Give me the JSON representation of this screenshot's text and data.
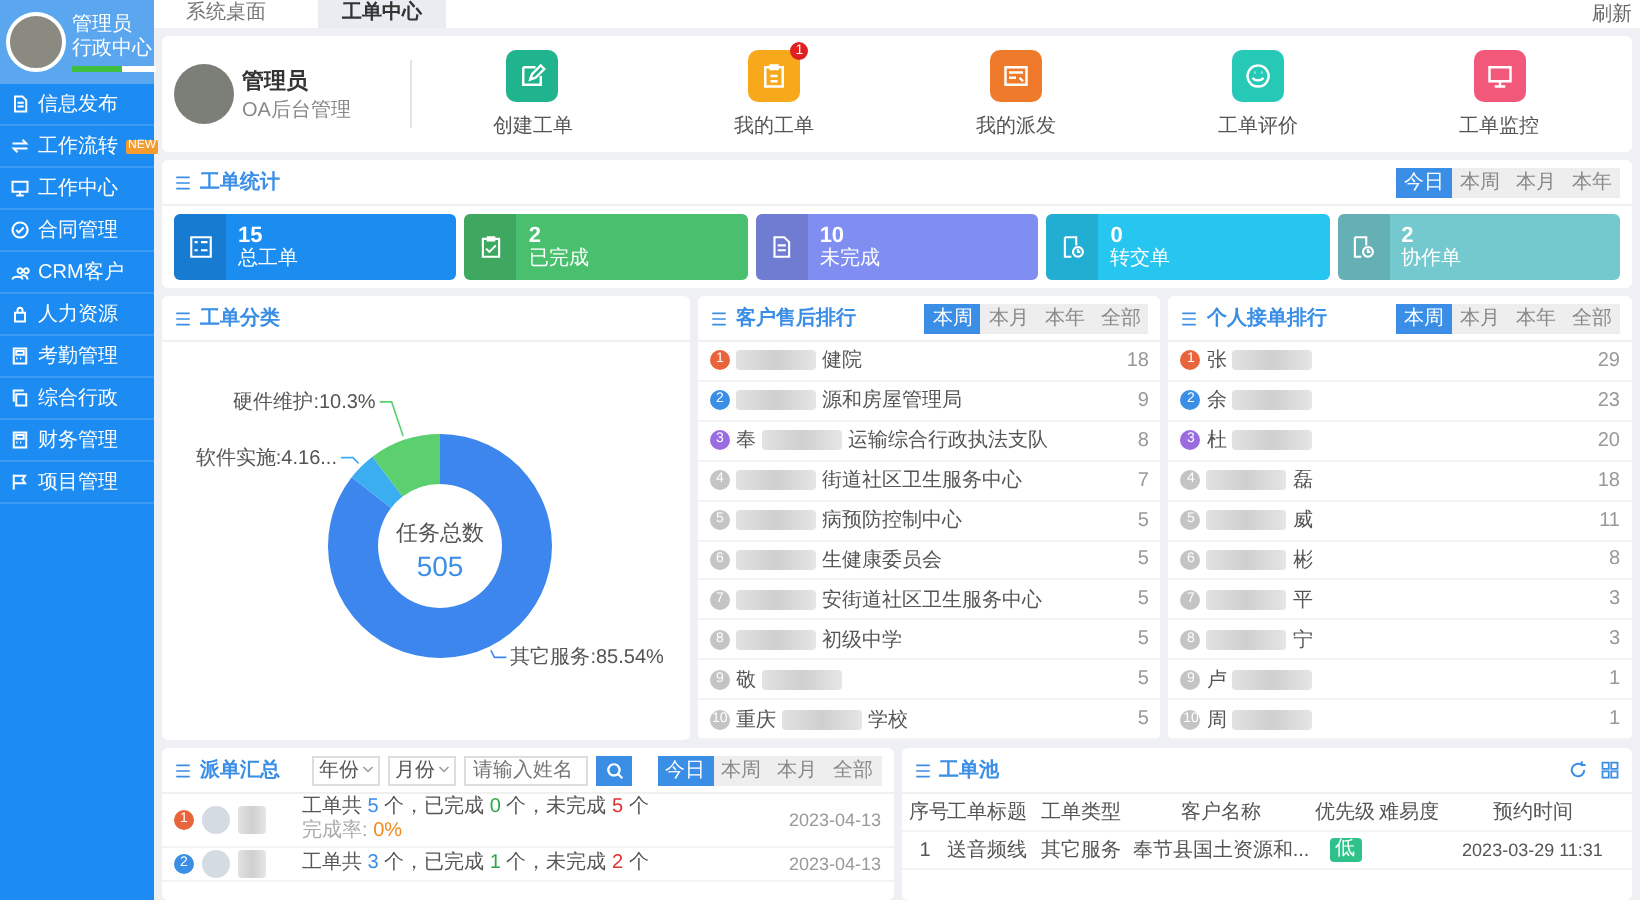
{
  "top_tabs": [
    {
      "label": "系统桌面",
      "selected": false
    },
    {
      "label": "工单中心",
      "selected": true
    }
  ],
  "top_right": "刷新",
  "sidebar": {
    "user": {
      "name": "管理员",
      "dept": "行政中心",
      "level": 0.6
    },
    "items": [
      {
        "label": "信息发布",
        "selected": false
      },
      {
        "label": "工作流转",
        "badge": "NEW",
        "selected": false
      },
      {
        "label": "工作中心",
        "selected": false
      },
      {
        "label": "合同管理",
        "selected": false
      },
      {
        "label": "CRM客户",
        "selected": false
      },
      {
        "label": "人力资源",
        "selected": false
      },
      {
        "label": "考勤管理",
        "selected": false
      },
      {
        "label": "综合行政",
        "selected": false
      },
      {
        "label": "财务管理",
        "selected": false
      },
      {
        "label": "项目管理",
        "selected": false
      }
    ]
  },
  "profile": {
    "name": "管理员",
    "role": "OA后台管理"
  },
  "quick_actions": [
    {
      "label": "创建工单",
      "color": "#1fb48e"
    },
    {
      "label": "我的工单",
      "color": "#f7a81b",
      "badge": "1"
    },
    {
      "label": "我的派发",
      "color": "#ef7a2c"
    },
    {
      "label": "工单评价",
      "color": "#25c9b5"
    },
    {
      "label": "工单监控",
      "color": "#f2587a"
    }
  ],
  "stats": {
    "title": "工单统计",
    "periods": [
      {
        "label": "今日",
        "selected": true
      },
      {
        "label": "本周",
        "selected": false
      },
      {
        "label": "本月",
        "selected": false
      },
      {
        "label": "本年",
        "selected": false
      }
    ],
    "cards": [
      {
        "value": "15",
        "label": "总工单",
        "color": "#1b8cf0"
      },
      {
        "value": "2",
        "label": "已完成",
        "color": "#48c06e"
      },
      {
        "value": "10",
        "label": "未完成",
        "color": "#7f8ef0"
      },
      {
        "value": "0",
        "label": "转交单",
        "color": "#27c6f0"
      },
      {
        "value": "2",
        "label": "协作单",
        "color": "#74c9cf"
      }
    ]
  },
  "category": {
    "title": "工单分类",
    "center_label": "任务总数",
    "center_value": "505",
    "chart_data": {
      "type": "donut",
      "categories": [
        "其它服务",
        "软件实施",
        "硬件维护"
      ],
      "values": [
        85.54,
        4.16,
        10.3
      ],
      "value_labels": [
        ":85.54%",
        ":4.16...",
        ":10.3%"
      ]
    }
  },
  "customer_rank": {
    "title": "客户售后排行",
    "periods": [
      {
        "label": "本周",
        "selected": true
      },
      {
        "label": "本月",
        "selected": false
      },
      {
        "label": "本年",
        "selected": false
      },
      {
        "label": "全部",
        "selected": false
      }
    ],
    "items": [
      {
        "rank": "1",
        "name": "健院",
        "count": "18",
        "color": "#e8643c",
        "redacted": true
      },
      {
        "rank": "2",
        "name": "源和房屋管理局",
        "count": "9",
        "color": "#3a8ee6",
        "redacted": true
      },
      {
        "rank": "3",
        "prefix": "奉",
        "name": "运输综合行政执法支队",
        "count": "8",
        "color": "#9b6be0",
        "redacted": true
      },
      {
        "rank": "4",
        "name": "街道社区卫生服务中心",
        "count": "7",
        "color": "#c4c4c4",
        "redacted": true
      },
      {
        "rank": "5",
        "name": "病预防控制中心",
        "count": "5",
        "color": "#c4c4c4",
        "redacted": true
      },
      {
        "rank": "6",
        "name": "生健康委员会",
        "count": "5",
        "color": "#c4c4c4",
        "redacted": true
      },
      {
        "rank": "7",
        "name": "安街道社区卫生服务中心",
        "count": "5",
        "color": "#c4c4c4",
        "redacted": true
      },
      {
        "rank": "8",
        "name": "初级中学",
        "count": "5",
        "color": "#c4c4c4",
        "redacted": true
      },
      {
        "rank": "9",
        "prefix": "敬",
        "count": "5",
        "color": "#c4c4c4",
        "redacted": true
      },
      {
        "rank": "10",
        "prefix": "重庆",
        "name": "学校",
        "count": "5",
        "color": "#c4c4c4",
        "redacted": true
      }
    ]
  },
  "person_rank": {
    "title": "个人接单排行",
    "periods": [
      {
        "label": "本周",
        "selected": true
      },
      {
        "label": "本月",
        "selected": false
      },
      {
        "label": "本年",
        "selected": false
      },
      {
        "label": "全部",
        "selected": false
      }
    ],
    "items": [
      {
        "rank": "1",
        "prefix": "张",
        "count": "29",
        "color": "#e8643c",
        "redacted": true
      },
      {
        "rank": "2",
        "prefix": "余",
        "count": "23",
        "color": "#3a8ee6",
        "redacted": true
      },
      {
        "rank": "3",
        "prefix": "杜",
        "count": "20",
        "color": "#9b6be0",
        "redacted": true
      },
      {
        "rank": "4",
        "name": "磊",
        "count": "18",
        "color": "#c4c4c4",
        "redacted": true
      },
      {
        "rank": "5",
        "name": "威",
        "count": "11",
        "color": "#c4c4c4",
        "redacted": true
      },
      {
        "rank": "6",
        "name": "彬",
        "count": "8",
        "color": "#c4c4c4",
        "redacted": true
      },
      {
        "rank": "7",
        "name": "平",
        "count": "3",
        "color": "#c4c4c4",
        "redacted": true
      },
      {
        "rank": "8",
        "name": "宁",
        "count": "3",
        "color": "#c4c4c4",
        "redacted": true
      },
      {
        "rank": "9",
        "prefix": "卢",
        "count": "1",
        "color": "#c4c4c4",
        "redacted": true
      },
      {
        "rank": "10",
        "prefix": "周",
        "count": "1",
        "color": "#c4c4c4",
        "redacted": true
      }
    ]
  },
  "dispatch": {
    "title": "派单汇总",
    "year_select": "年份",
    "month_select": "月份",
    "search": {
      "placeholder": "请输入姓名"
    },
    "periods": [
      {
        "label": "今日",
        "selected": true
      },
      {
        "label": "本周",
        "selected": false
      },
      {
        "label": "本月",
        "selected": false
      },
      {
        "label": "全部",
        "selected": false
      }
    ],
    "rows": [
      {
        "rank": "1",
        "color": "#e8643c",
        "summary": [
          {
            "kind": "plain",
            "text": "工单共 "
          },
          {
            "kind": "total",
            "text": "5"
          },
          {
            "kind": "plain",
            "text": " 个，已完成 "
          },
          {
            "kind": "done",
            "text": "0"
          },
          {
            "kind": "plain",
            "text": " 个，未完成 "
          },
          {
            "kind": "undone",
            "text": "5"
          },
          {
            "kind": "plain",
            "text": " 个"
          }
        ],
        "rate": [
          {
            "kind": "muted",
            "text": "完成率: "
          },
          {
            "kind": "rate",
            "text": "0%"
          }
        ],
        "date": "2023-04-13"
      },
      {
        "rank": "2",
        "color": "#3a8ee6",
        "summary": [
          {
            "kind": "plain",
            "text": "工单共 "
          },
          {
            "kind": "total",
            "text": "3"
          },
          {
            "kind": "plain",
            "text": " 个，已完成 "
          },
          {
            "kind": "done",
            "text": "1"
          },
          {
            "kind": "plain",
            "text": " 个，未完成 "
          },
          {
            "kind": "undone",
            "text": "2"
          },
          {
            "kind": "plain",
            "text": " 个"
          }
        ],
        "date": "2023-04-13"
      }
    ]
  },
  "pool": {
    "title": "工单池",
    "columns": [
      "序号",
      "工单标题",
      "工单类型",
      "客户名称",
      "优先级",
      "难易度",
      "预约时间"
    ],
    "rows": [
      {
        "no": "1",
        "title": "送音频线",
        "type": "其它服务",
        "customer": "奉节县国土资源和...",
        "priority": "低",
        "time": "2023-03-29 11:31"
      }
    ]
  }
}
